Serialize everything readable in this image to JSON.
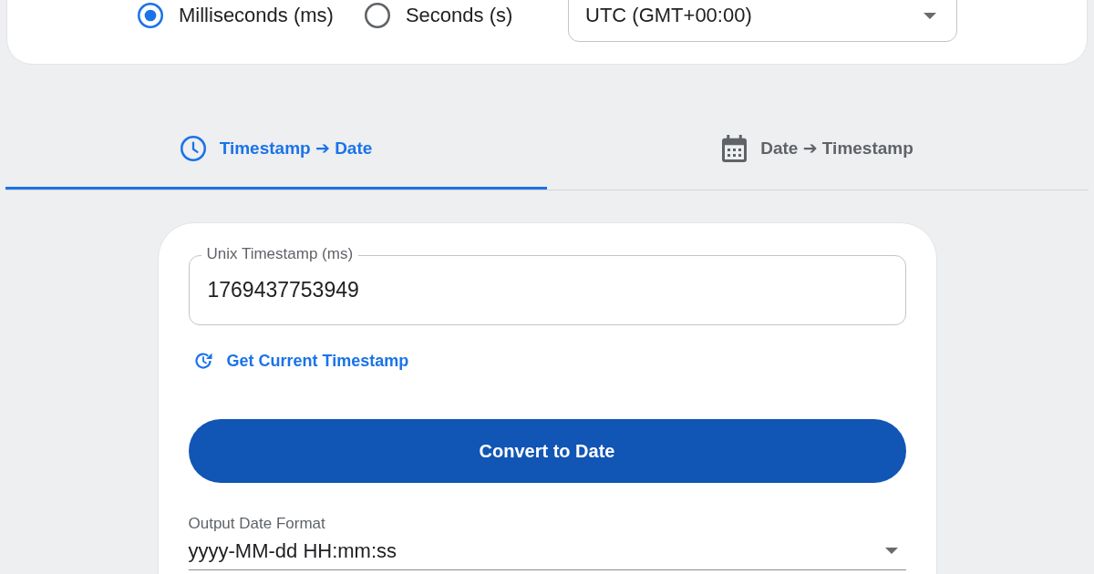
{
  "settings": {
    "unit_options": [
      {
        "label": "Milliseconds (ms)",
        "selected": true
      },
      {
        "label": "Seconds (s)",
        "selected": false
      }
    ],
    "timezone": {
      "value": "UTC (GMT+00:00)"
    }
  },
  "tabs": [
    {
      "label": "Timestamp ➔ Date",
      "selected": true
    },
    {
      "label": "Date ➔ Timestamp",
      "selected": false
    }
  ],
  "converter": {
    "timestamp_field": {
      "label": "Unix Timestamp (ms)",
      "value": "1769437753949"
    },
    "current_link": "Get Current Timestamp",
    "convert_button": "Convert to Date",
    "format_field": {
      "label": "Output Date Format",
      "value": "yyyy-MM-dd HH:mm:ss"
    }
  }
}
